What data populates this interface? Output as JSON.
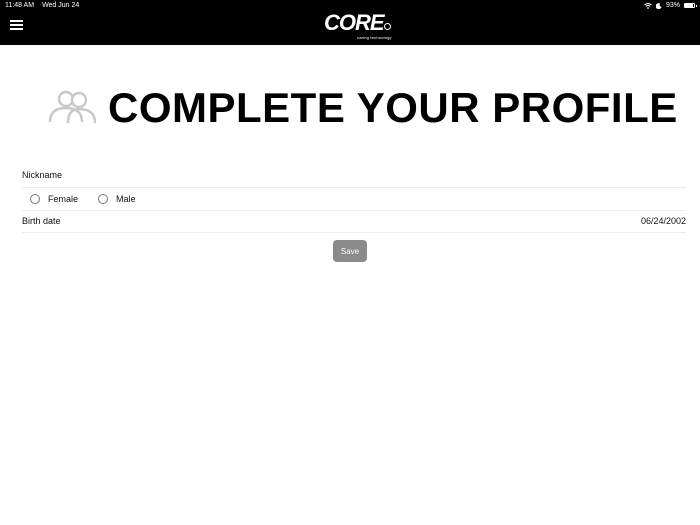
{
  "status_bar": {
    "time": "11:48 AM",
    "date": "Wed Jun 24",
    "battery": "93%",
    "icons": [
      "wifi-icon",
      "moon-icon",
      "battery-icon"
    ]
  },
  "header": {
    "brand": "CORE",
    "tagline": "caring technology",
    "menu_icon": "hamburger-menu-icon",
    "background": "#000000"
  },
  "page": {
    "title": "COMPLETE YOUR PROFILE",
    "title_icon": "users-icon"
  },
  "form": {
    "nickname_placeholder": "Nickname",
    "nickname_value": "",
    "gender_options": [
      "Female",
      "Male"
    ],
    "birth_label": "Birth date",
    "birth_value": "06/24/2002",
    "save_label": "Save",
    "save_color": "#8a8a8a"
  }
}
